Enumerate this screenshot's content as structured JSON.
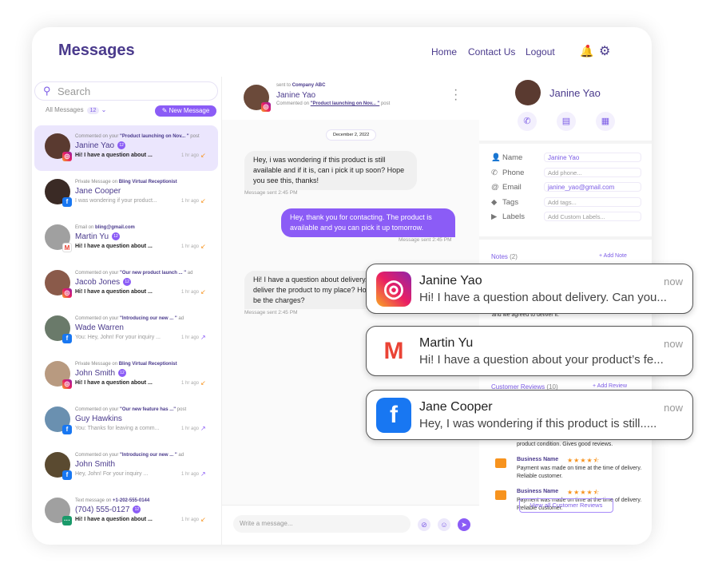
{
  "header": {
    "title": "Messages",
    "nav": [
      "Home",
      "Contact Us",
      "Logout"
    ],
    "icons": [
      "bell-icon",
      "gear-icon"
    ]
  },
  "sidebar": {
    "search_placeholder": "Search",
    "filter": "All Messages",
    "filter_count": "12",
    "new_message": "New Message",
    "items": [
      {
        "meta_pre": "Commented on your",
        "meta_link": "\"Product launching on Nov... \"",
        "meta_post": "post",
        "name": "Janine Yao",
        "badge": "12",
        "preview": "Hi! I have a question about ...",
        "time": "1 hr ago",
        "platform": "instagram",
        "direction": "incoming",
        "unread": true,
        "selected": true,
        "avatar": "#5a3a30"
      },
      {
        "meta_pre": "Private Message on",
        "meta_link": "Bling Virtual Receptionist",
        "meta_post": "",
        "name": "Jane Cooper",
        "badge": "",
        "preview": "I was wondering if your product...",
        "time": "1 hr ago",
        "platform": "facebook",
        "direction": "incoming",
        "unread": false,
        "avatar": "#3a2a25"
      },
      {
        "meta_pre": "Email on",
        "meta_link": "bling@gmail.com",
        "meta_post": "",
        "name": "Martin Yu",
        "badge": "12",
        "preview": "Hi! I have a question about ...",
        "time": "1 hr ago",
        "platform": "gmail",
        "direction": "incoming",
        "unread": true,
        "avatar": "#a0a0a0"
      },
      {
        "meta_pre": "Commented on your",
        "meta_link": "\"Our new product launch ... \"",
        "meta_post": "ad",
        "name": "Jacob Jones",
        "badge": "12",
        "preview": "Hi! I have a question about ...",
        "time": "1 hr ago",
        "platform": "instagram",
        "direction": "incoming",
        "unread": true,
        "avatar": "#8a5a4a"
      },
      {
        "meta_pre": "Commented on your",
        "meta_link": "\"Introducing our new ... \"",
        "meta_post": "ad",
        "name": "Wade Warren",
        "badge": "",
        "preview": "You: Hey, John! For your inquiry ...",
        "time": "1 hr ago",
        "platform": "facebook",
        "direction": "outgoing",
        "unread": false,
        "avatar": "#6a7a6a"
      },
      {
        "meta_pre": "Private Message on",
        "meta_link": "Bling Virtual Receptionist",
        "meta_post": "",
        "name": "John Smith",
        "badge": "12",
        "preview": "Hi! I have a question about ...",
        "time": "1 hr ago",
        "platform": "instagram",
        "direction": "incoming",
        "unread": true,
        "avatar": "#b89a80"
      },
      {
        "meta_pre": "Commented on your",
        "meta_link": "\"Our new feature has ...\"",
        "meta_post": "post",
        "name": "Guy Hawkins",
        "badge": "",
        "preview": "You: Thanks for leaving a comm...",
        "time": "1 hr ago",
        "platform": "facebook",
        "direction": "outgoing",
        "unread": false,
        "avatar": "#6a90b0"
      },
      {
        "meta_pre": "Commented on your",
        "meta_link": "\"Introducing our new ... \"",
        "meta_post": "ad",
        "name": "John Smith",
        "badge": "",
        "preview": "Hey, John! For your inquiry ...",
        "time": "1 hr ago",
        "platform": "facebook",
        "direction": "outgoing",
        "unread": false,
        "avatar": "#5a4a30"
      },
      {
        "meta_pre": "Text message on",
        "meta_link": "+1-202-555-0144",
        "meta_post": "",
        "name": "(704) 555-0127",
        "badge": "12",
        "preview": "Hi! I have a question about ...",
        "time": "1 hr ago",
        "platform": "sms",
        "direction": "incoming",
        "unread": true,
        "avatar": "#a0a0a0"
      }
    ]
  },
  "chat": {
    "sent_to_label": "sent to",
    "sent_to": "Company ABC",
    "name": "Janine Yao",
    "commented_on": "Commented on",
    "post_link": "\"Product launching on Nov... \"",
    "post_suffix": "post",
    "date": "December 2, 2022",
    "messages": [
      {
        "dir": "in",
        "text": "Hey, i was wondering if this product is still available and if it is, can i pick it up soon? Hope you see this, thanks!",
        "sent": "Message sent 2:45 PM"
      },
      {
        "dir": "out",
        "text": "Hey, thank you for contacting. The product is available and you can pick it up tomorrow.",
        "sent": "Message sent 2:45 PM"
      },
      {
        "dir": "in",
        "text": "Hi! I have a question about delivery. Can you deliver the product to my place? How much will be the charges?",
        "sent": "Message sent 2:45 PM"
      }
    ],
    "composer_placeholder": "Write a message..."
  },
  "contact": {
    "name": "Janine Yao",
    "fields": [
      {
        "label": "Name",
        "value": "Janine Yao",
        "filled": true,
        "icon": "person-icon"
      },
      {
        "label": "Phone",
        "value": "Add phone...",
        "filled": false,
        "icon": "phone-icon"
      },
      {
        "label": "Email",
        "value": "janine_yao@gmail.com",
        "filled": true,
        "icon": "at-icon"
      },
      {
        "label": "Tags",
        "value": "Add tags...",
        "filled": false,
        "icon": "tag-icon"
      },
      {
        "label": "Labels",
        "value": "Add Custom Labels...",
        "filled": false,
        "icon": "label-icon"
      }
    ],
    "notes_label": "Notes",
    "notes_count": "(2)",
    "add_note": "+ Add Note",
    "note_text": "and we agreed to deliver it.",
    "reviews_label": "Customer Reviews",
    "reviews_count": "(10)",
    "add_review": "+ Add Review",
    "review_partial": "product condition. Gives good reviews.",
    "reviews": [
      {
        "business": "Business Name",
        "rating": 4.5,
        "text": "Payment was made on time at the time of delivery. Reliable customer."
      },
      {
        "business": "Business Name",
        "rating": 4.5,
        "text": "Payment was made on time at the time of delivery. Reliable customer."
      }
    ],
    "view_all": "View all Customer Reviews"
  },
  "notifications": [
    {
      "platform": "instagram",
      "name": "Janine Yao",
      "time": "now",
      "text": "Hi! I have a question about delivery. Can you..."
    },
    {
      "platform": "gmail",
      "name": "Martin Yu",
      "time": "now",
      "text": "Hi! I have a question about your product’s fe..."
    },
    {
      "platform": "facebook",
      "name": "Jane Cooper",
      "time": "now",
      "text": "Hey, I was wondering if this product is still....."
    }
  ],
  "colors": {
    "brand": "#4a3a8c",
    "accent": "#8b5cf6",
    "incoming_arrow": "#f7931e",
    "outgoing_arrow": "#8b5cf6"
  }
}
